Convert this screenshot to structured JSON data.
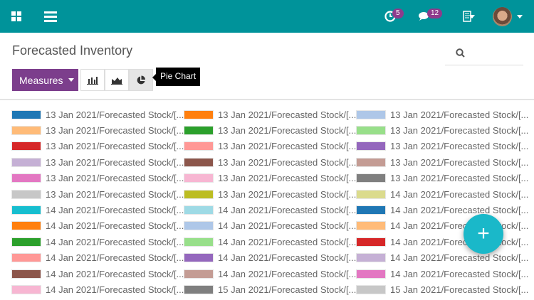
{
  "header": {
    "activity_count": "5",
    "messages_count": "12"
  },
  "page": {
    "title": "Forecasted Inventory"
  },
  "toolbar": {
    "measures_label": "Measures",
    "tooltip": "Pie Chart"
  },
  "chart_data": {
    "type": "pie",
    "title": "",
    "legend_placement": "top",
    "legend": [
      "13 Jan 2021/Forecasted Stock/[...",
      "13 Jan 2021/Forecasted Stock/[...",
      "13 Jan 2021/Forecasted Stock/[...",
      "13 Jan 2021/Forecasted Stock/[...",
      "13 Jan 2021/Forecasted Stock/[...",
      "13 Jan 2021/Forecasted Stock/[...",
      "13 Jan 2021/Forecasted Stock/[...",
      "13 Jan 2021/Forecasted Stock/[...",
      "13 Jan 2021/Forecasted Stock/[...",
      "13 Jan 2021/Forecasted Stock/[...",
      "13 Jan 2021/Forecasted Stock/[...",
      "13 Jan 2021/Forecasted Stock/[...",
      "13 Jan 2021/Forecasted Stock/[...",
      "13 Jan 2021/Forecasted Stock/[...",
      "13 Jan 2021/Forecasted Stock/[...",
      "13 Jan 2021/Forecasted Stock/[...",
      "13 Jan 2021/Forecasted Stock/[...",
      "14 Jan 2021/Forecasted Stock/[...",
      "14 Jan 2021/Forecasted Stock/[...",
      "14 Jan 2021/Forecasted Stock/[...",
      "14 Jan 2021/Forecasted Stock/[...",
      "14 Jan 2021/Forecasted Stock/[...",
      "14 Jan 2021/Forecasted Stock/[...",
      "14 Jan 2021/Forecasted Stock/[...",
      "14 Jan 2021/Forecasted Stock/[...",
      "14 Jan 2021/Forecasted Stock/[...",
      "14 Jan 2021/Forecasted Stock/[...",
      "14 Jan 2021/Forecasted Stock/[...",
      "14 Jan 2021/Forecasted Stock/[...",
      "14 Jan 2021/Forecasted Stock/[...",
      "14 Jan 2021/Forecasted Stock/[...",
      "14 Jan 2021/Forecasted Stock/[...",
      "14 Jan 2021/Forecasted Stock/[...",
      "14 Jan 2021/Forecasted Stock/[...",
      "15 Jan 2021/Forecasted Stock/[...",
      "15 Jan 2021/Forecasted Stock/[..."
    ],
    "palette": [
      "#1f77b4",
      "#ff7f0e",
      "#aec7e8",
      "#ffbb78",
      "#2ca02c",
      "#98df8a",
      "#d62728",
      "#ff9896",
      "#9467bd",
      "#c5b0d5",
      "#8c564b",
      "#c49c94",
      "#e377c2",
      "#f7b6d2",
      "#7f7f7f",
      "#c7c7c7",
      "#bcbd22",
      "#dbdb8d",
      "#17becf",
      "#9edae5"
    ]
  },
  "colors": {
    "topbar": "#00939a",
    "accent": "#7c3e8c",
    "fab": "#1ab8c9"
  }
}
